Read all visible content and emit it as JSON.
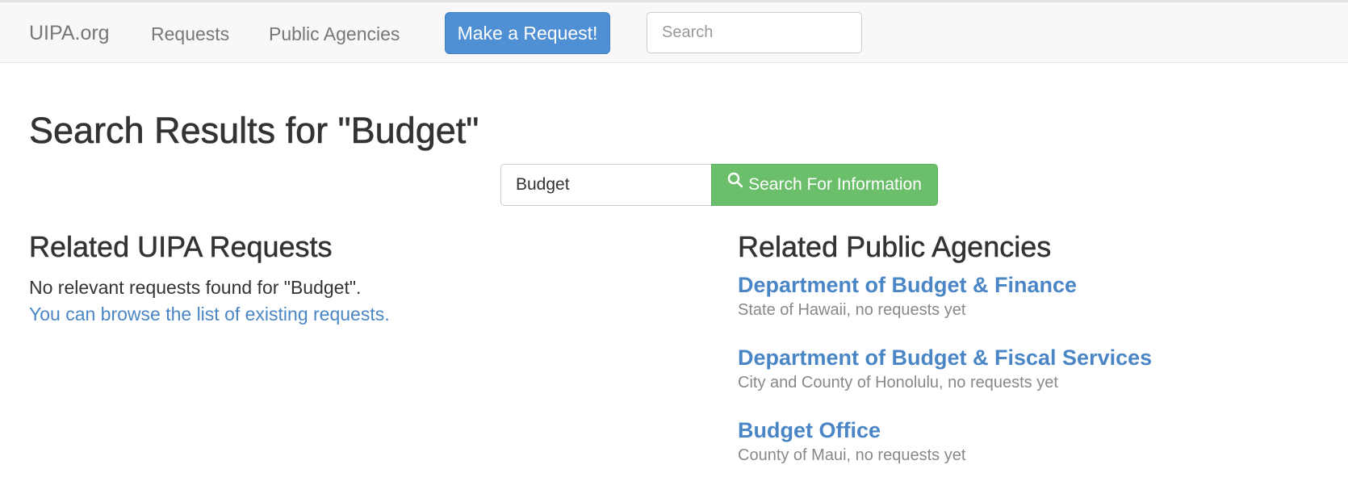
{
  "navbar": {
    "brand": "UIPA.org",
    "links": [
      "Requests",
      "Public Agencies"
    ],
    "make_request_label": "Make a Request!",
    "search_placeholder": "Search"
  },
  "page": {
    "title": "Search Results for \"Budget\""
  },
  "search": {
    "value": "Budget",
    "button_label": "Search For Information",
    "button_icon": "search-icon"
  },
  "requests_section": {
    "title": "Related UIPA Requests",
    "empty_message": "No relevant requests found for \"Budget\".",
    "browse_link": "You can browse the list of existing requests."
  },
  "agencies_section": {
    "title": "Related Public Agencies",
    "items": [
      {
        "name": "Department of Budget & Finance",
        "meta": "State of Hawaii, no requests yet"
      },
      {
        "name": "Department of Budget & Fiscal Services",
        "meta": "City and County of Honolulu, no requests yet"
      },
      {
        "name": "Budget Office",
        "meta": "County of Maui, no requests yet"
      }
    ]
  },
  "colors": {
    "primary": "#4f8fd4",
    "success": "#6bbf6b",
    "link": "#4a86c5"
  }
}
